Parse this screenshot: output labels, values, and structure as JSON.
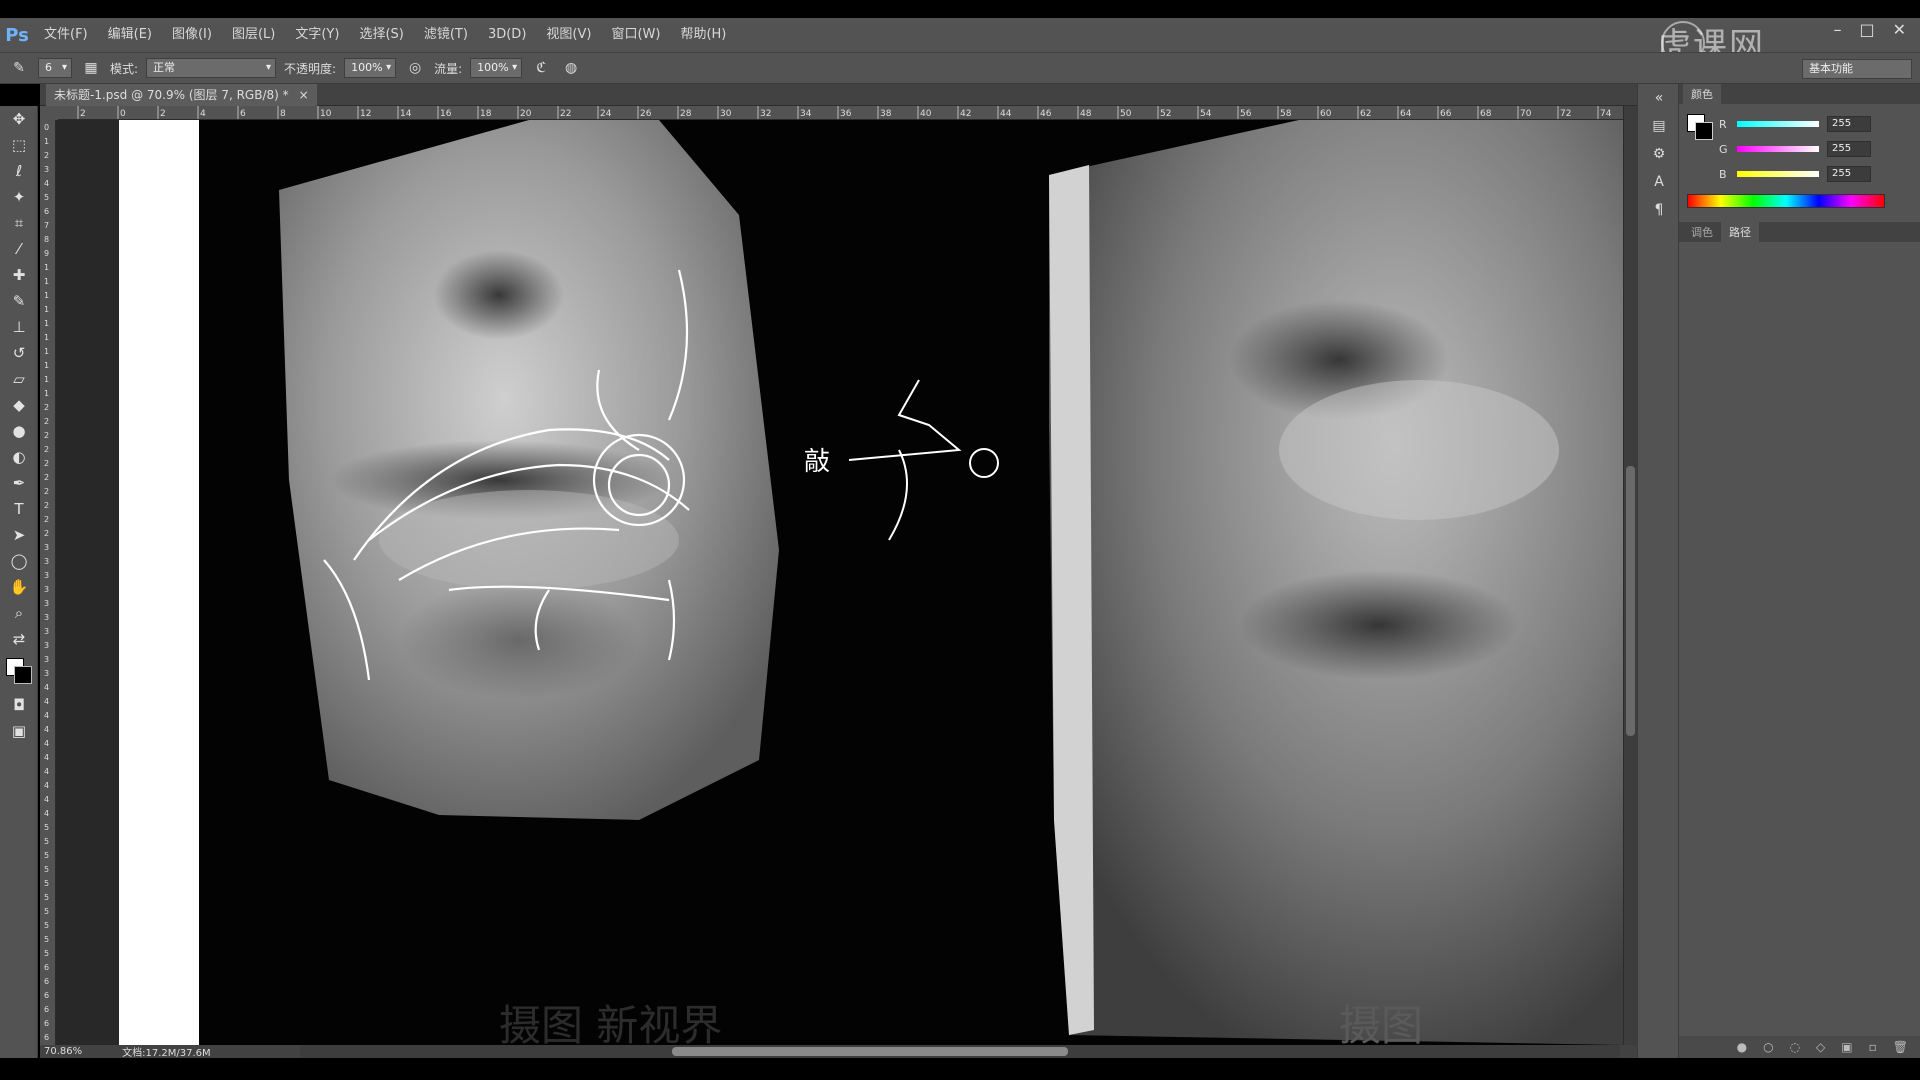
{
  "app": {
    "logo": "Ps",
    "menu": [
      "文件(F)",
      "编辑(E)",
      "图像(I)",
      "图层(L)",
      "文字(Y)",
      "选择(S)",
      "滤镜(T)",
      "3D(D)",
      "视图(V)",
      "窗口(W)",
      "帮助(H)"
    ],
    "watermark": "虎课网",
    "window_controls": [
      "–",
      "□",
      "✕"
    ]
  },
  "options": {
    "brush_size": "6",
    "mode_label": "模式:",
    "mode_value": "正常",
    "opacity_label": "不透明度:",
    "opacity_value": "100%",
    "flow_label": "流量:",
    "flow_value": "100%",
    "workspace": "基本功能"
  },
  "document": {
    "tab_title": "未标题-1.psd @ 70.9% (图层 7, RGB/8) *",
    "close": "×"
  },
  "ruler_top_labels": [
    "2",
    "0",
    "2",
    "4",
    "6",
    "8",
    "10",
    "12",
    "14",
    "16",
    "18",
    "20",
    "22",
    "24",
    "26",
    "28",
    "30",
    "32",
    "34",
    "36",
    "38",
    "40",
    "42",
    "44",
    "46",
    "48",
    "50",
    "52",
    "54",
    "56",
    "58",
    "60",
    "62",
    "64",
    "66",
    "68",
    "70",
    "72",
    "74"
  ],
  "ruler_left_labels": [
    "0",
    "1",
    "2",
    "3",
    "4",
    "5",
    "6",
    "7",
    "8",
    "9",
    "1",
    "1",
    "1",
    "1",
    "1",
    "1",
    "1",
    "1",
    "1",
    "1",
    "2",
    "2",
    "2",
    "2",
    "2",
    "2",
    "2",
    "2",
    "2",
    "2",
    "3",
    "3",
    "3",
    "3",
    "3",
    "3",
    "3",
    "3",
    "3",
    "3",
    "4",
    "4",
    "4",
    "4",
    "4",
    "4",
    "4",
    "4",
    "4",
    "4",
    "5",
    "5",
    "5",
    "5",
    "5",
    "5",
    "5",
    "5",
    "5",
    "5",
    "6",
    "6",
    "6",
    "6",
    "6",
    "6"
  ],
  "status": {
    "zoom": "70.86%",
    "doc_info": "文档:17.2M/37.6M"
  },
  "canvas": {
    "sketch_note": "敲",
    "bottom_watermark_left": "摄图 新视界",
    "bottom_watermark_right": "摄图"
  },
  "color_panel": {
    "tab": "颜色",
    "r_label": "R",
    "g_label": "G",
    "b_label": "B",
    "r": "255",
    "g": "255",
    "b": "255",
    "tabs2": [
      "调色",
      "路径"
    ]
  }
}
